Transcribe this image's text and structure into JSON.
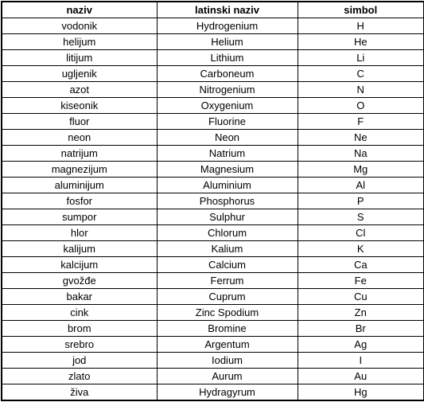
{
  "table": {
    "headers": [
      "naziv",
      "latinski naziv",
      "simbol"
    ],
    "rows": [
      [
        "vodonik",
        "Hydrogenium",
        "H"
      ],
      [
        "helijum",
        "Helium",
        "He"
      ],
      [
        "litijum",
        "Lithium",
        "Li"
      ],
      [
        "ugljenik",
        "Carboneum",
        "C"
      ],
      [
        "azot",
        "Nitrogenium",
        "N"
      ],
      [
        "kiseonik",
        "Oxygenium",
        "O"
      ],
      [
        "fluor",
        "Fluorine",
        "F"
      ],
      [
        "neon",
        "Neon",
        "Ne"
      ],
      [
        "natrijum",
        "Natrium",
        "Na"
      ],
      [
        "magnezijum",
        "Magnesium",
        "Mg"
      ],
      [
        "aluminijum",
        "Aluminium",
        "Al"
      ],
      [
        "fosfor",
        "Phosphorus",
        "P"
      ],
      [
        "sumpor",
        "Sulphur",
        "S"
      ],
      [
        "hlor",
        "Chlorum",
        "Cl"
      ],
      [
        "kalijum",
        "Kalium",
        "K"
      ],
      [
        "kalcijum",
        "Calcium",
        "Ca"
      ],
      [
        "gvožđe",
        "Ferrum",
        "Fe"
      ],
      [
        "bakar",
        "Cuprum",
        "Cu"
      ],
      [
        "cink",
        "Zinc Spodium",
        "Zn"
      ],
      [
        "brom",
        "Bromine",
        "Br"
      ],
      [
        "srebro",
        "Argentum",
        "Ag"
      ],
      [
        "jod",
        "Iodium",
        "I"
      ],
      [
        "zlato",
        "Aurum",
        "Au"
      ],
      [
        "živa",
        "Hydragyrum",
        "Hg"
      ]
    ]
  }
}
